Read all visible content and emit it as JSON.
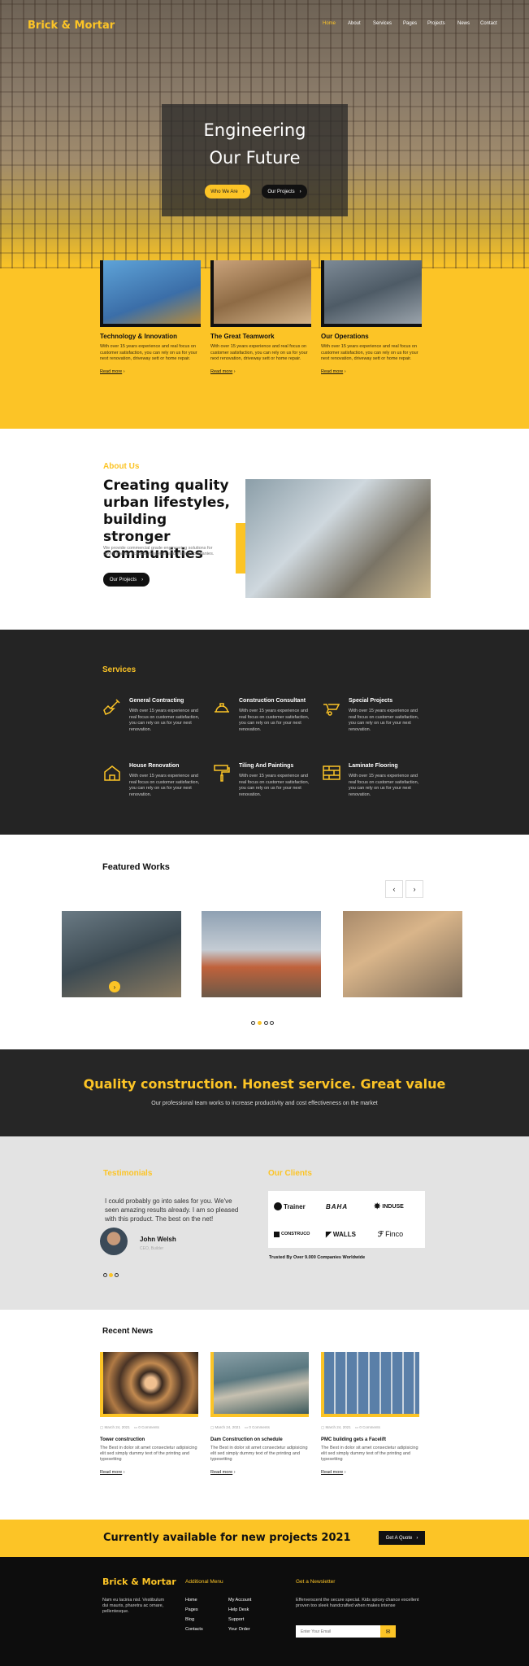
{
  "brand": "Brick & Mortar",
  "nav": [
    "Home",
    "About",
    "Services",
    "Pages",
    "Projects",
    "News",
    "Contact"
  ],
  "hero": {
    "title_line1": "Engineering",
    "title_line2": "Our Future",
    "btn_primary": "Who We Are",
    "btn_secondary": "Our Projects"
  },
  "features": [
    {
      "title": "Technology & Innovation",
      "text": "With over 15 years experience and real focus on customer satisfaction, you can rely on us for your next renovation, driveway sett or home repair.",
      "link": "Read more"
    },
    {
      "title": "The Great Teamwork",
      "text": "With over 15 years experience and real focus on customer satisfaction, you can rely on us for your next renovation, driveway sett or home repair.",
      "link": "Read more"
    },
    {
      "title": "Our Operations",
      "text": "With over 15 years experience and real focus on customer satisfaction, you can rely on us for your next renovation, driveway sett or home repair.",
      "link": "Read more"
    }
  ],
  "about": {
    "kicker": "About Us",
    "title": "Creating quality urban lifestyles, building stronger communities",
    "text": "We provide commercial grade engineering solutions for governments, schools, hospitals and mining companies.",
    "button": "Our Projects"
  },
  "services": {
    "heading": "Services",
    "items": [
      {
        "title": "General Contracting",
        "icon": "shovel-icon",
        "text": "With over 15 years experience and real focus on customer satisfaction, you can rely on us for your next renovation."
      },
      {
        "title": "Construction Consultant",
        "icon": "hardhat-icon",
        "text": "With over 15 years experience and real focus on customer satisfaction, you can rely on us for your next renovation."
      },
      {
        "title": "Special Projects",
        "icon": "wheelbarrow-icon",
        "text": "With over 15 years experience and real focus on customer satisfaction, you can rely on us for your next renovation."
      },
      {
        "title": "House Renovation",
        "icon": "house-icon",
        "text": "With over 15 years experience and real focus on customer satisfaction, you can rely on us for your next renovation."
      },
      {
        "title": "Tiling And Paintings",
        "icon": "paint-roller-icon",
        "text": "With over 15 years experience and real focus on customer satisfaction, you can rely on us for your next renovation."
      },
      {
        "title": "Laminate Flooring",
        "icon": "bricks-icon",
        "text": "With over 15 years experience and real focus on customer satisfaction, you can rely on us for your next renovation."
      }
    ]
  },
  "featured": {
    "heading": "Featured Works"
  },
  "quality": {
    "title": "Quality construction. Honest service. Great value",
    "text": "Our professional team works to increase productivity and cost effectiveness on the market"
  },
  "testimonials": {
    "heading": "Testimonials",
    "quote": "I could probably go into sales for you. We've seen amazing results already. I am so pleased with this product. The best on the net!",
    "name": "John Welsh",
    "role": "CEO, Builder"
  },
  "clients": {
    "heading": "Our Clients",
    "logos": [
      "Trainer",
      "BAHA",
      "INDUSE",
      "CONSTRUCO",
      "WALLS",
      "Finco"
    ],
    "caption": "Trusted By Over 9.000 Companies Worldwide"
  },
  "news": {
    "heading": "Recent News",
    "items": [
      {
        "date": "March 24, 2021",
        "comments": "0 Comments",
        "title": "Tower construction",
        "text": "The Best in dolor sit amet consectetur adipisicing elit sed simply dummy text of the printing and typesetting",
        "link": "Read more"
      },
      {
        "date": "March 24, 2021",
        "comments": "0 Comments",
        "title": "Dam Construction on schedule",
        "text": "The Best in dolor sit amet consectetur adipisicing elit sed simply dummy text of the printing and typesetting",
        "link": "Read more"
      },
      {
        "date": "March 24, 2021",
        "comments": "0 Comments",
        "title": "PMC building gets a Facelift",
        "text": "The Best in dolor sit amet consectetur adipisicing elit sed simply dummy text of the printing and typesetting",
        "link": "Read more"
      }
    ]
  },
  "cta": {
    "text": "Currently available for new projects 2021",
    "button": "Get A Quote"
  },
  "footer": {
    "about": "Nam eu lacinia nisl. Vestibulum dui mauris, pharetra ac ornare, pellentesque.",
    "menu_heading": "Additional Menu",
    "menu_col1": [
      "Home",
      "Pages",
      "Blog",
      "Contacts"
    ],
    "menu_col2": [
      "My Account",
      "Help Desk",
      "Support",
      "Your Order"
    ],
    "news_heading": "Get a Newsletter",
    "news_text": "Efferverscent the secure special. Kids spicey chance excellent proven too sleek handcrafted when makes intense",
    "email_placeholder": "Enter Your Email"
  },
  "colors": {
    "accent": "#fcc426",
    "dark": "#242424"
  }
}
